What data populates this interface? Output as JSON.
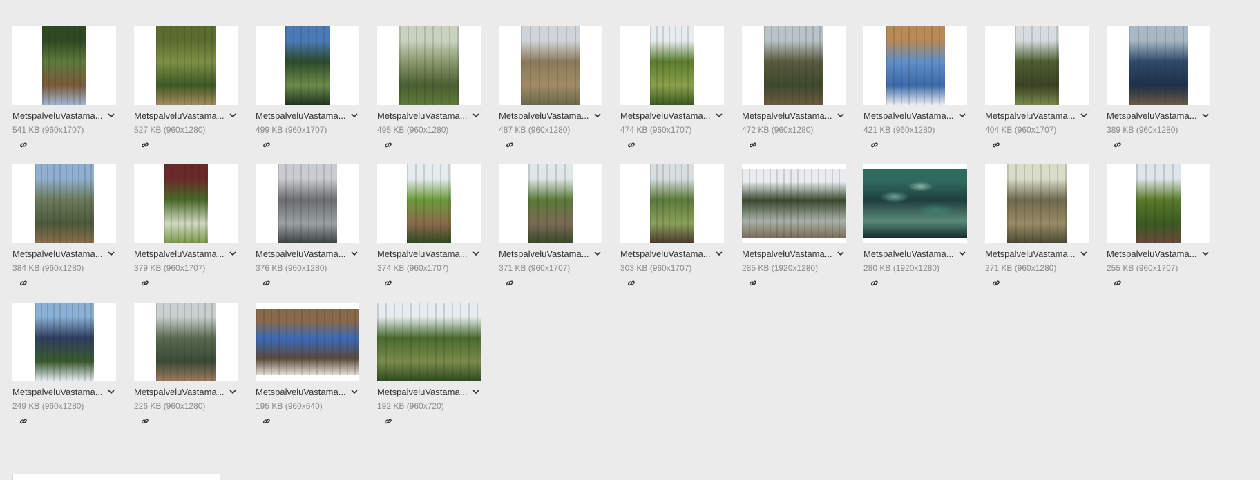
{
  "files": [
    {
      "name": "MetspalveluVastama...",
      "size": "541 KB (960x1707)",
      "orient": "portrait",
      "palette": [
        "#5e7a3c",
        "#2f4a22",
        "#9fb8d6",
        "#7a5a3a"
      ]
    },
    {
      "name": "MetspalveluVastama...",
      "size": "527 KB (960x1280)",
      "orient": "portrait",
      "palette": [
        "#7c8f45",
        "#5a6d2e",
        "#a58c5e",
        "#3e5a24"
      ]
    },
    {
      "name": "MetspalveluVastama...",
      "size": "499 KB (960x1707)",
      "orient": "portrait",
      "palette": [
        "#2d4a2a",
        "#4a7bb8",
        "#1e3520",
        "#6b8c4a"
      ]
    },
    {
      "name": "MetspalveluVastama...",
      "size": "495 KB (960x1280)",
      "orient": "portrait",
      "palette": [
        "#8a9a6c",
        "#c9d2c0",
        "#5f7a3a",
        "#4a5e30"
      ]
    },
    {
      "name": "MetspalveluVastama...",
      "size": "487 KB (960x1280)",
      "orient": "portrait",
      "palette": [
        "#8a7a5a",
        "#cfd4d8",
        "#6a6a4a",
        "#a08a66"
      ]
    },
    {
      "name": "MetspalveluVastama...",
      "size": "474 KB (960x1707)",
      "orient": "portrait",
      "palette": [
        "#5a7d2e",
        "#e7ecef",
        "#3a5a22",
        "#8aa04a"
      ]
    },
    {
      "name": "MetspalveluVastama...",
      "size": "472 KB (960x1280)",
      "orient": "portrait",
      "palette": [
        "#5a5a3e",
        "#b9c3c8",
        "#6e5a40",
        "#3e4a2e"
      ]
    },
    {
      "name": "MetspalveluVastama...",
      "size": "421 KB (960x1280)",
      "orient": "portrait",
      "palette": [
        "#5f8fc9",
        "#b88a56",
        "#e9eef5",
        "#3a6aa8"
      ]
    },
    {
      "name": "MetspalveluVastama...",
      "size": "404 KB (960x1707)",
      "orient": "portrait",
      "palette": [
        "#4e5e30",
        "#d6dcdf",
        "#7a8a4a",
        "#3a4226"
      ]
    },
    {
      "name": "MetspalveluVastama...",
      "size": "389 KB (960x1280)",
      "orient": "portrait",
      "palette": [
        "#2e4a6a",
        "#a8b8c6",
        "#6a5a46",
        "#1e3048"
      ]
    },
    {
      "name": "MetspalveluVastama...",
      "size": "384 KB (960x1280)",
      "orient": "portrait",
      "palette": [
        "#6a7a5a",
        "#8fb0d0",
        "#8a6e4e",
        "#4a5a3a"
      ]
    },
    {
      "name": "MetspalveluVastama...",
      "size": "379 KB (960x1707)",
      "orient": "portrait",
      "palette": [
        "#4a6a2a",
        "#6a2a2a",
        "#7a9a4a",
        "#cfd8c0"
      ]
    },
    {
      "name": "MetspalveluVastama...",
      "size": "376 KB (960x1280)",
      "orient": "portrait",
      "palette": [
        "#6a6e70",
        "#c8ccd0",
        "#3e4244",
        "#9aa0a4"
      ]
    },
    {
      "name": "MetspalveluVastama...",
      "size": "374 KB (960x1707)",
      "orient": "portrait",
      "palette": [
        "#6a9a3a",
        "#e6ebee",
        "#2e4a22",
        "#8a6a4a"
      ]
    },
    {
      "name": "MetspalveluVastama...",
      "size": "371 KB (960x1707)",
      "orient": "portrait",
      "palette": [
        "#5a7a3a",
        "#e1e6e8",
        "#3a4a26",
        "#7a6a56"
      ]
    },
    {
      "name": "MetspalveluVastama...",
      "size": "303 KB (960x1707)",
      "orient": "portrait",
      "palette": [
        "#5a7a3a",
        "#d8dde0",
        "#4a3a2e",
        "#8aa05a"
      ]
    },
    {
      "name": "MetspalveluVastama...",
      "size": "285 KB (1920x1280)",
      "orient": "landscape",
      "palette": [
        "#3a4a2e",
        "#e8ecee",
        "#7a6a56",
        "#a8b0a8"
      ]
    },
    {
      "name": "MetspalveluVastama...",
      "size": "280 KB (1920x1280)",
      "orient": "landscape",
      "palette": [
        "#1f3f3e",
        "#2f6a5e",
        "#0f2a2a",
        "#5a8a7a"
      ]
    },
    {
      "name": "MetspalveluVastama...",
      "size": "271 KB (960x1280)",
      "orient": "portrait",
      "palette": [
        "#6e6a4e",
        "#d8dcc8",
        "#4a4a34",
        "#9a8a66"
      ]
    },
    {
      "name": "MetspalveluVastama...",
      "size": "255 KB (960x1707)",
      "orient": "portrait",
      "palette": [
        "#5a7a2a",
        "#dfe5ea",
        "#6a4a3a",
        "#3a5a22"
      ]
    },
    {
      "name": "MetspalveluVastama...",
      "size": "249 KB (960x1280)",
      "orient": "portrait",
      "palette": [
        "#2e3e5e",
        "#8ab0d8",
        "#e8eef6",
        "#3a5a2e"
      ]
    },
    {
      "name": "MetspalveluVastama...",
      "size": "226 KB (960x1280)",
      "orient": "portrait",
      "palette": [
        "#5a6a4e",
        "#c8d0d0",
        "#a07a5e",
        "#3a4a36"
      ]
    },
    {
      "name": "MetspalveluVastama...",
      "size": "195 KB (960x640)",
      "orient": "landscape",
      "palette": [
        "#3a6ab8",
        "#8a6a4a",
        "#e8e0d8",
        "#5a4a3a"
      ]
    },
    {
      "name": "MetspalveluVastama...",
      "size": "192 KB (960x720)",
      "orient": "landscape",
      "palette": [
        "#4a6a2e",
        "#e6ecef",
        "#2e4a22",
        "#7a8a4a"
      ]
    }
  ],
  "icons": {
    "menu": "chevron-down-icon",
    "link": "link-icon"
  }
}
